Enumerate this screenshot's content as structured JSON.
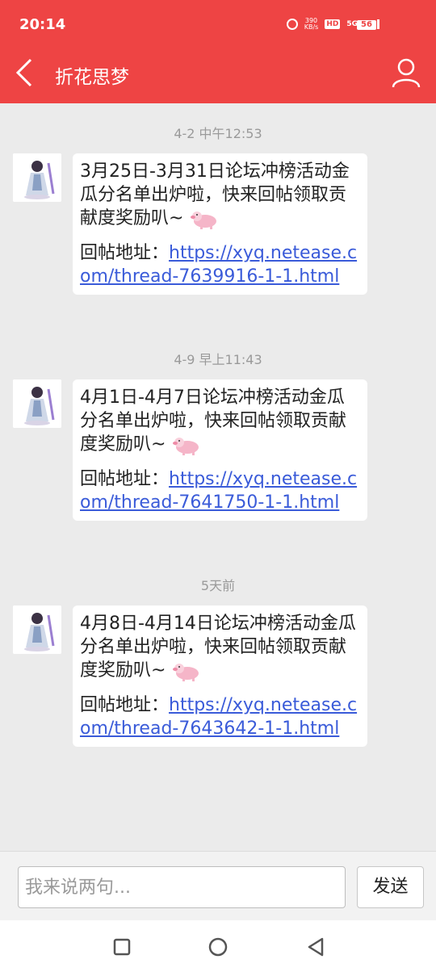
{
  "status_bar": {
    "time": "20:14",
    "net_speed": "390",
    "net_unit": "KB/s",
    "hd_badge": "HD",
    "network": "5G",
    "battery": "56"
  },
  "header": {
    "title": "折花思梦"
  },
  "messages": [
    {
      "timestamp": "4-2 中午12:53",
      "text": "3月25日-3月31日论坛冲榜活动金瓜分名单出炉啦，快来回帖领取贡献度奖励叭~",
      "link_label": "回帖地址：",
      "link": "https://xyq.netease.com/thread-7639916-1-1.html"
    },
    {
      "timestamp": "4-9 早上11:43",
      "text": "4月1日-4月7日论坛冲榜活动金瓜分名单出炉啦，快来回帖领取贡献度奖励叭~",
      "link_label": "回帖地址：",
      "link": "https://xyq.netease.com/thread-7641750-1-1.html"
    },
    {
      "timestamp": "5天前",
      "text": "4月8日-4月14日论坛冲榜活动金瓜分名单出炉啦，快来回帖领取贡献度奖励叭~",
      "link_label": "回帖地址：",
      "link": "https://xyq.netease.com/thread-7643642-1-1.html"
    }
  ],
  "input_bar": {
    "placeholder": "我来说两句...",
    "send_label": "发送"
  },
  "colors": {
    "header_bg": "#ee4444",
    "link": "#3a5bd9",
    "page_bg": "#ebebeb"
  }
}
